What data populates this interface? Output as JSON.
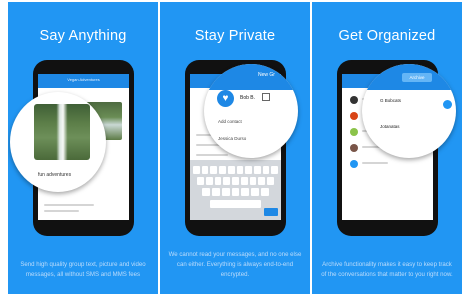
{
  "panels": [
    {
      "title": "Say Anything",
      "description": "Send high quality group text, picture and video messages, all without SMS and MMS fees",
      "appbar_title": "Vegan Adventures",
      "lens_caption": "fun adventures"
    },
    {
      "title": "Stay Private",
      "description": "We cannot read your messages, and no one else can either. Everything is always end-to-end encrypted.",
      "appbar_title": "New Gr",
      "contact_name": "Bob B.",
      "labels": [
        "Add contact",
        "Jessica Durso"
      ]
    },
    {
      "title": "Get Organized",
      "description": "Archive functionality makes it easy to keep track of the conversations that matter to you right now.",
      "tab_label": "Archive",
      "rows": [
        "G Bobcats",
        "Jotanatas"
      ]
    }
  ],
  "colors": {
    "panel_bg": "#2196F3",
    "appbar": "#1e88e5",
    "accent_light": "#64b5f6"
  },
  "icons": {
    "heart": "♥"
  }
}
